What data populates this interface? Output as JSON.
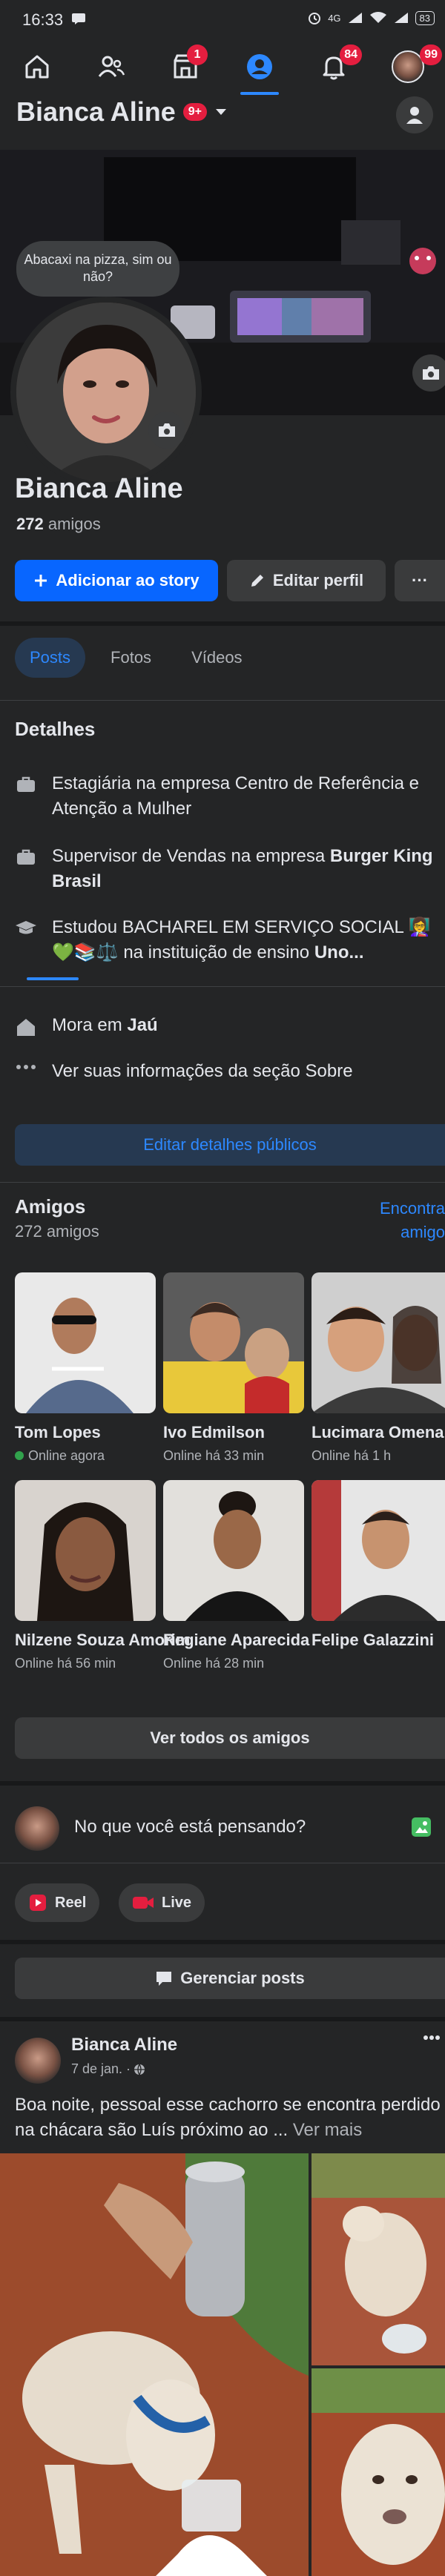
{
  "status": {
    "time": "16:33",
    "network": "4G",
    "battery": "83"
  },
  "nav": {
    "items": [
      {
        "name": "home",
        "badge": ""
      },
      {
        "name": "friends",
        "badge": ""
      },
      {
        "name": "marketplace",
        "badge": "1"
      },
      {
        "name": "profile",
        "badge": ""
      },
      {
        "name": "notifications",
        "badge": "84"
      },
      {
        "name": "menu",
        "badge": "99"
      }
    ]
  },
  "profile": {
    "header_name": "Bianca Aline",
    "header_badge": "9+",
    "bubble_text": "Abacaxi na pizza, sim ou não?",
    "name": "Bianca Aline",
    "friends_count": "272",
    "friends_word": "amigos",
    "add_story": "Adicionar ao story",
    "edit_profile": "Editar perfil",
    "more": "···"
  },
  "tabs": [
    {
      "label": "Posts"
    },
    {
      "label": "Fotos"
    },
    {
      "label": "Vídeos"
    }
  ],
  "details": {
    "title": "Detalhes",
    "items": [
      {
        "icon": "briefcase-icon",
        "text": "Estagiária na empresa Centro de Referência e Atenção a Mulher"
      },
      {
        "icon": "briefcase-icon",
        "prefix": "Supervisor de Vendas na empresa ",
        "bold": "Burger King Brasil"
      },
      {
        "icon": "graduation-cap-icon",
        "prefix": "Estudou BACHAREL EM SERVIÇO SOCIAL 👩‍🏫💚📚⚖️ na instituição de ensino ",
        "bold": "Uno..."
      },
      {
        "icon": "home-icon",
        "prefix": "Mora em ",
        "bold": "Jaú"
      },
      {
        "icon": "dots-icon",
        "text": "Ver suas informações da seção Sobre"
      }
    ],
    "edit_public": "Editar detalhes públicos"
  },
  "friends": {
    "title": "Amigos",
    "subtitle": "272 amigos",
    "find_link_line1": "Encontra",
    "find_link_line2": "amigo",
    "list": [
      {
        "name": "Tom Lopes",
        "status": "Online agora",
        "online": true
      },
      {
        "name": "Ivo Edmilson",
        "status": "Online há 33 min",
        "online": false
      },
      {
        "name": "Lucimara Omena",
        "status": "Online há 1 h",
        "online": false
      },
      {
        "name": "Nilzene Souza Amorim",
        "status": "Online há 56 min",
        "online": false
      },
      {
        "name": "Regiane Aparecida",
        "status": "Online há 28 min",
        "online": false
      },
      {
        "name": "Felipe Galazzini",
        "status": "",
        "online": false
      }
    ],
    "see_all": "Ver todos os amigos"
  },
  "composer": {
    "placeholder": "No que você está pensando?",
    "reel": "Reel",
    "live": "Live",
    "manage_posts": "Gerenciar posts"
  },
  "post": {
    "author": "Bianca Aline",
    "date": "7 de jan. ·",
    "text": "Boa noite, pessoal esse cachorro se encontra perdido na chácara são Luís próximo ao ... ",
    "more": "Ver mais"
  },
  "colors": {
    "background": "#242526",
    "accent": "#2d88ff",
    "primary_button": "#0866ff",
    "badge": "#e41e3f",
    "online": "#31a24c"
  }
}
